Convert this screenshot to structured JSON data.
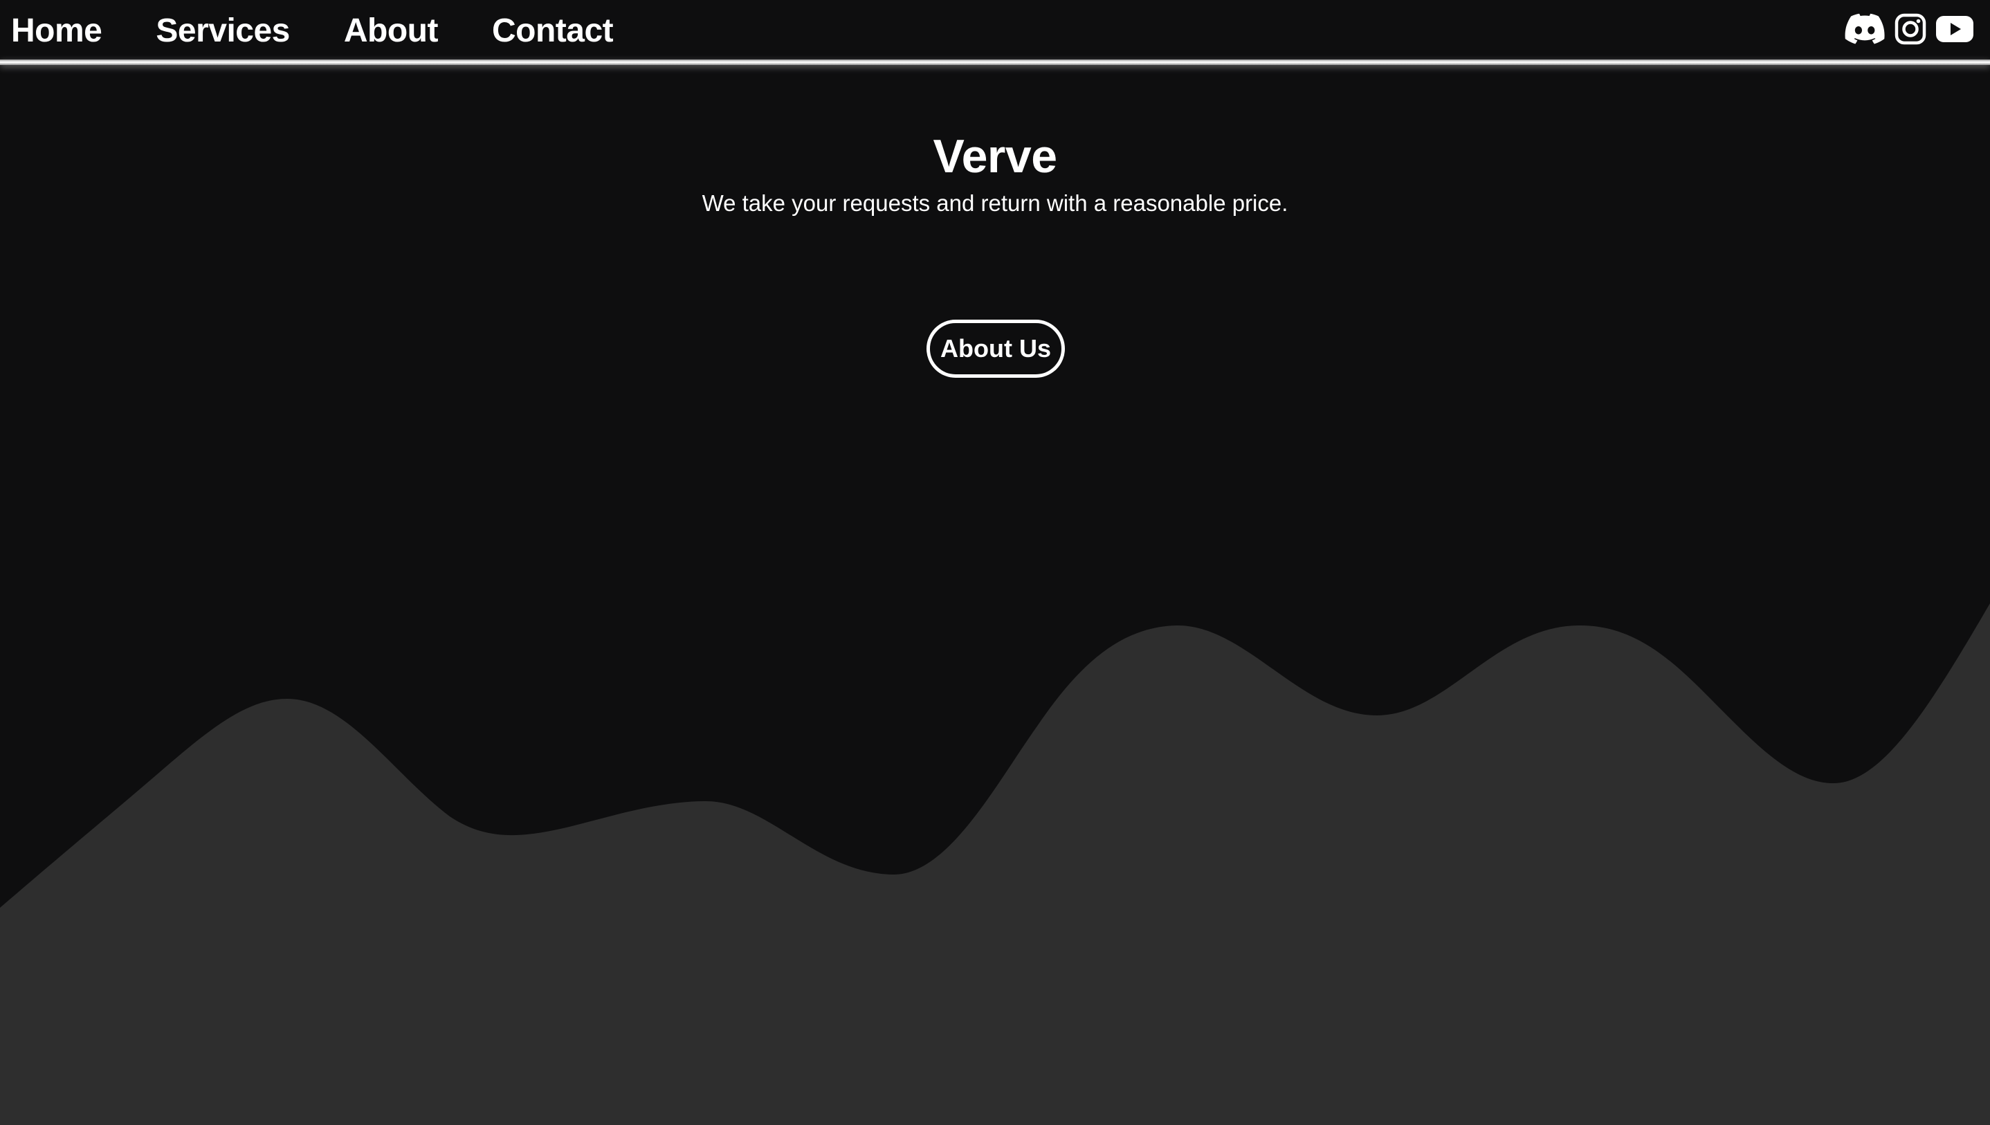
{
  "nav": {
    "links": [
      {
        "label": "Home"
      },
      {
        "label": "Services"
      },
      {
        "label": "About"
      },
      {
        "label": "Contact"
      }
    ],
    "social": [
      "discord-icon",
      "instagram-icon",
      "youtube-icon"
    ]
  },
  "hero": {
    "title": "Verve",
    "subtitle": "We take your requests and return with a reasonable price.",
    "button_label": "About Us"
  },
  "colors": {
    "background": "#0e0e0f",
    "wave": "#2e2e2e",
    "text": "#ffffff"
  }
}
